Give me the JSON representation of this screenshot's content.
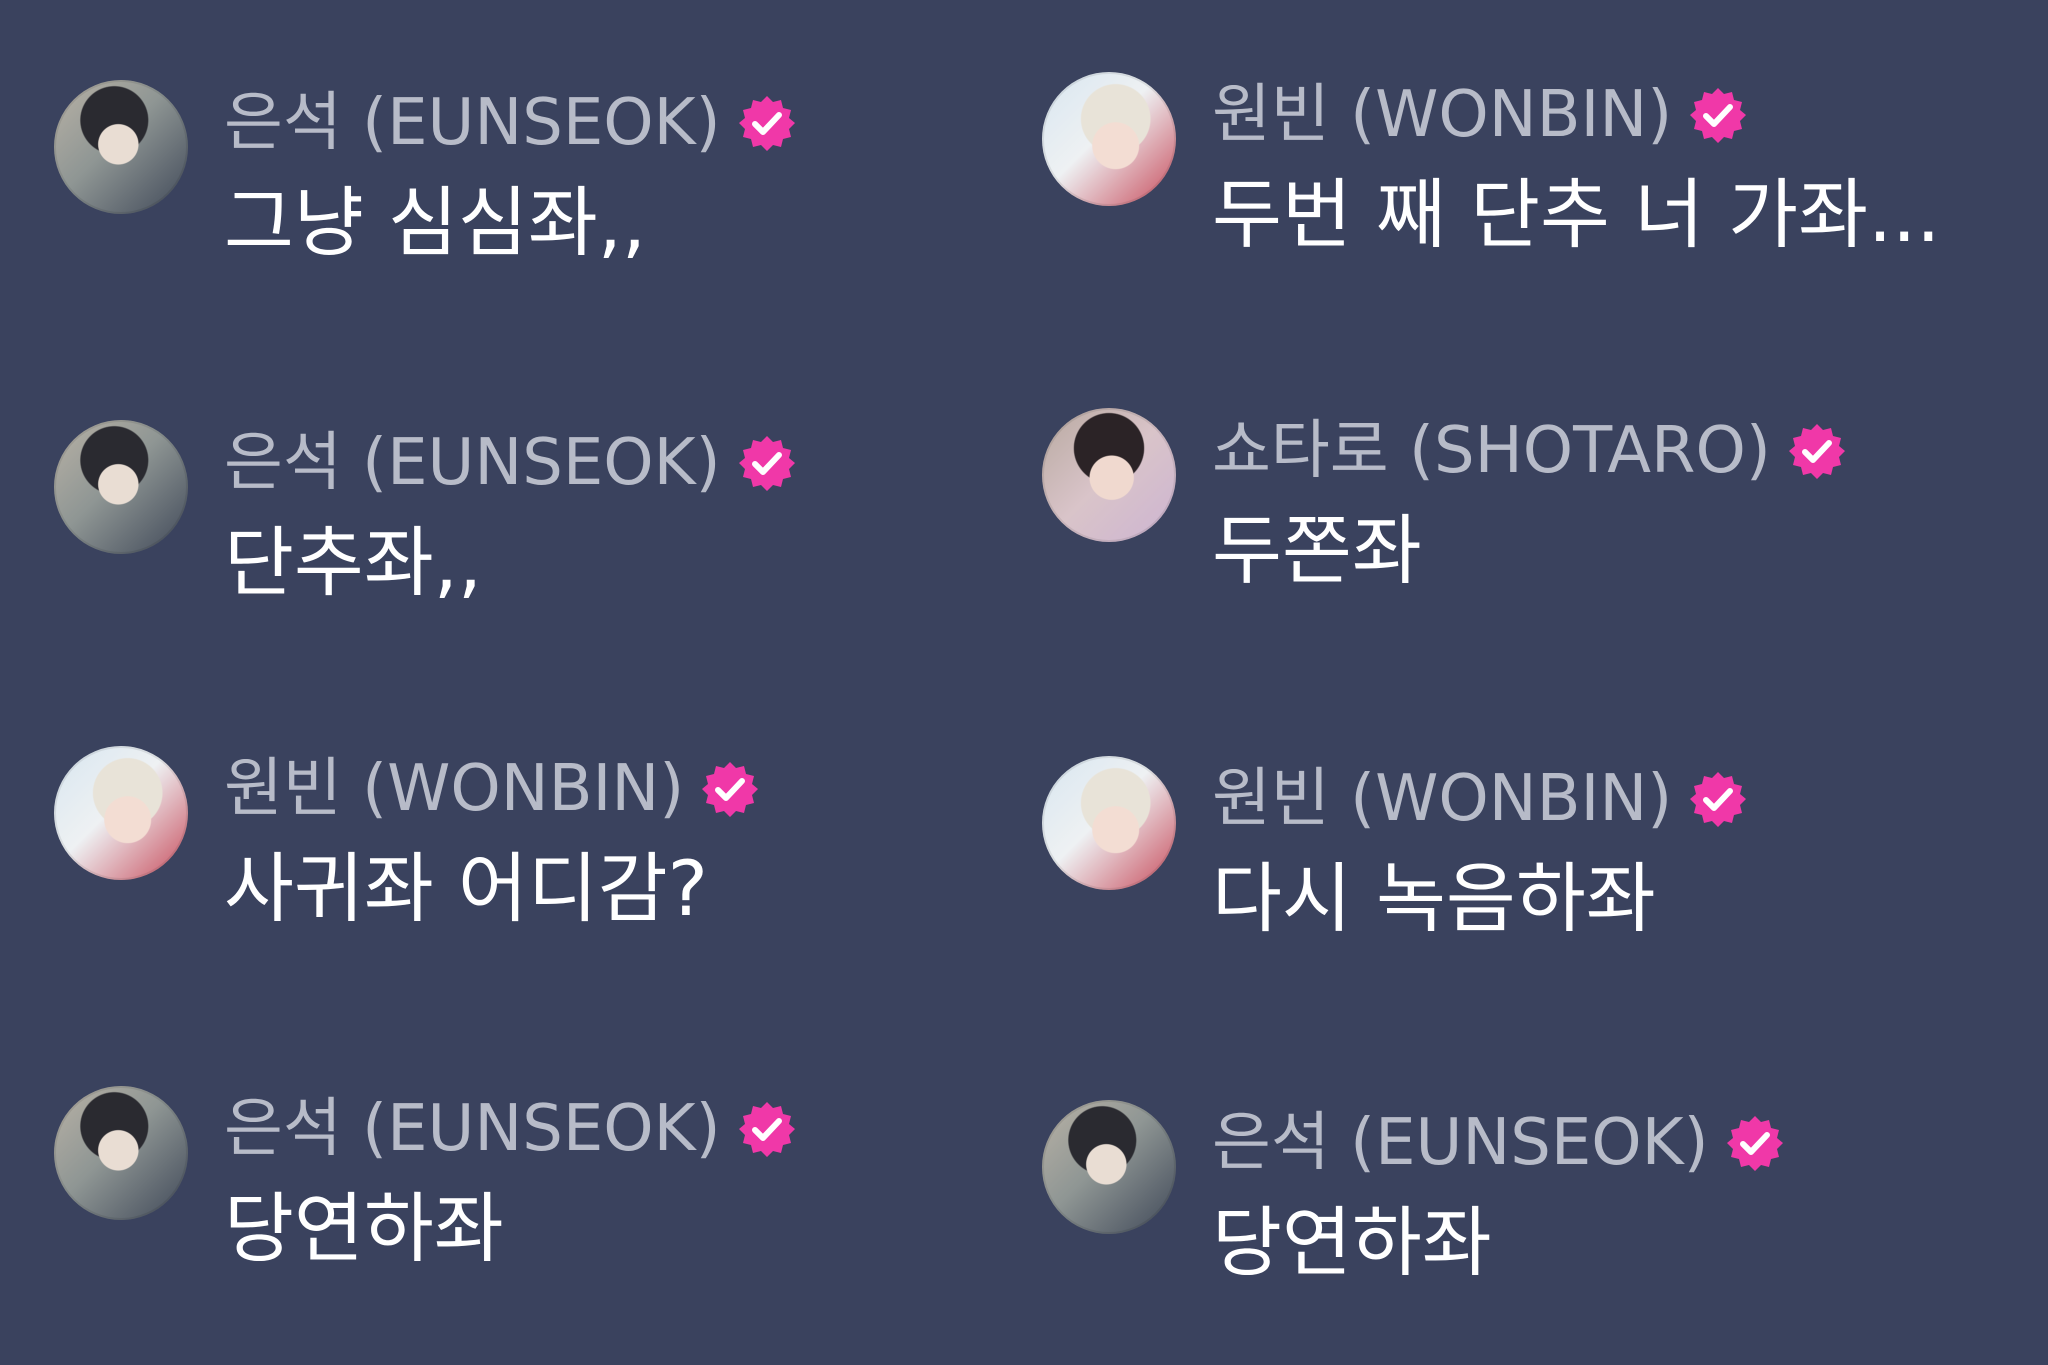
{
  "colors": {
    "background": "#3a425e",
    "name_text": "#b7bbc8",
    "message_text": "#ffffff",
    "verified_badge": "#f038a8"
  },
  "messages": [
    {
      "avatar": "eunseok-avatar",
      "name": "은석 (EUNSEOK)",
      "text": "그냥 심심좌,,",
      "verified": true
    },
    {
      "avatar": "wonbin-avatar",
      "name": "원빈 (WONBIN)",
      "text": "두번 째 단추 너 가좌...",
      "verified": true
    },
    {
      "avatar": "eunseok-avatar",
      "name": "은석 (EUNSEOK)",
      "text": "단추좌,,",
      "verified": true
    },
    {
      "avatar": "shotaro-avatar",
      "name": "쇼타로 (SHOTARO)",
      "text": "두쫀좌",
      "verified": true
    },
    {
      "avatar": "wonbin-avatar",
      "name": "원빈 (WONBIN)",
      "text": "사귀좌 어디감?",
      "verified": true
    },
    {
      "avatar": "wonbin-avatar",
      "name": "원빈 (WONBIN)",
      "text": "다시 녹음하좌",
      "verified": true
    },
    {
      "avatar": "eunseok-avatar",
      "name": "은석 (EUNSEOK)",
      "text": "당연하좌",
      "verified": true
    },
    {
      "avatar": "eunseok-avatar",
      "name": "은석 (EUNSEOK)",
      "text": "당연하좌",
      "verified": true
    }
  ]
}
